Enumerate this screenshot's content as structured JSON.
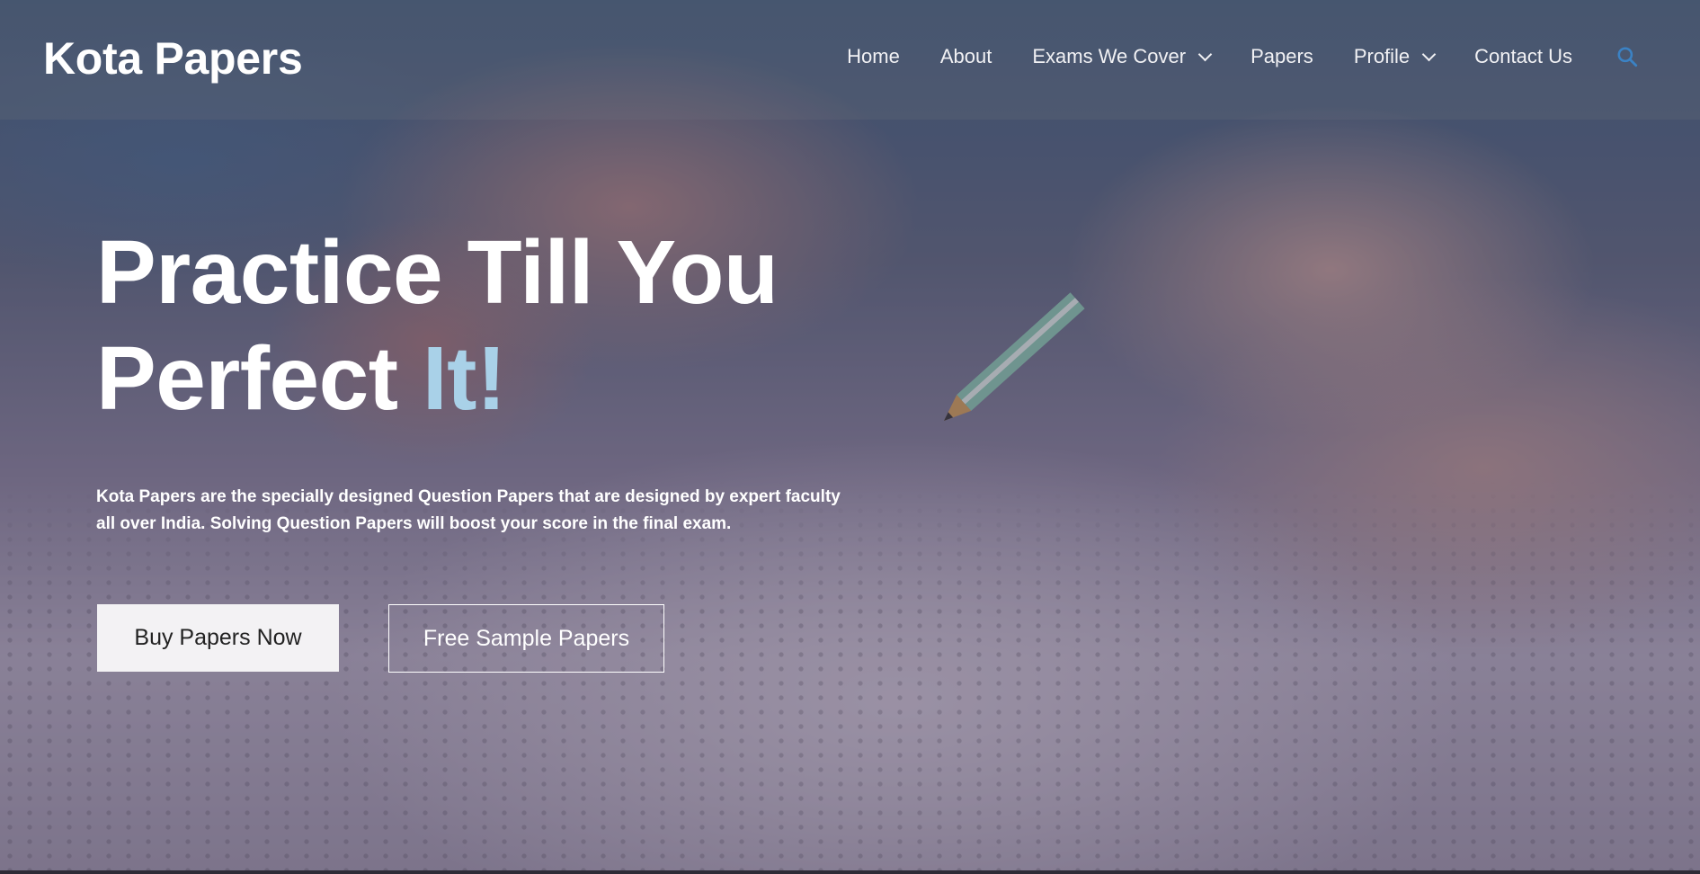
{
  "site": {
    "logo_text": "Kota Papers"
  },
  "nav": {
    "items": [
      {
        "label": "Home",
        "has_dropdown": false
      },
      {
        "label": "About",
        "has_dropdown": false
      },
      {
        "label": "Exams We Cover",
        "has_dropdown": true
      },
      {
        "label": "Papers",
        "has_dropdown": false
      },
      {
        "label": "Profile",
        "has_dropdown": true
      },
      {
        "label": "Contact Us",
        "has_dropdown": false
      }
    ],
    "search_icon": "search-icon",
    "search_icon_color": "#3b82c4"
  },
  "hero": {
    "headline_line1": "Practice Till You",
    "headline_line2_prefix": "Perfect ",
    "headline_line2_accent": "It!",
    "accent_color": "#a9d1e8",
    "description": "Kota Papers are the specially designed Question Papers that are designed by expert faculty all over India. Solving Question Papers will boost your score in the final exam.",
    "primary_button": "Buy Papers Now",
    "secondary_button": "Free Sample Papers",
    "background_image": "hand-with-pencil-filling-omr-answer-sheet"
  }
}
